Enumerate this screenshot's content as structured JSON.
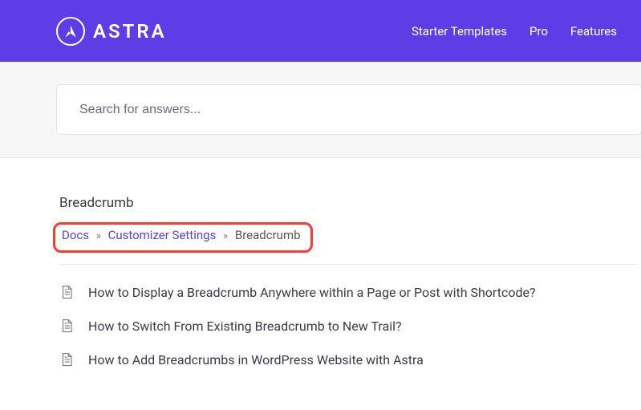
{
  "header": {
    "brand": "ASTRA",
    "nav": [
      {
        "label": "Starter Templates"
      },
      {
        "label": "Pro"
      },
      {
        "label": "Features"
      }
    ]
  },
  "search": {
    "placeholder": "Search for answers..."
  },
  "page": {
    "title": "Breadcrumb"
  },
  "breadcrumb": {
    "items": [
      {
        "label": "Docs",
        "link": true
      },
      {
        "label": "Customizer Settings",
        "link": true
      },
      {
        "label": "Breadcrumb",
        "link": false
      }
    ],
    "separator": "»"
  },
  "docs": [
    {
      "title": "How to Display a Breadcrumb Anywhere within a Page or Post with Shortcode?"
    },
    {
      "title": "How to Switch From Existing Breadcrumb to New Trail?"
    },
    {
      "title": "How to Add Breadcrumbs in WordPress Website with Astra"
    }
  ]
}
